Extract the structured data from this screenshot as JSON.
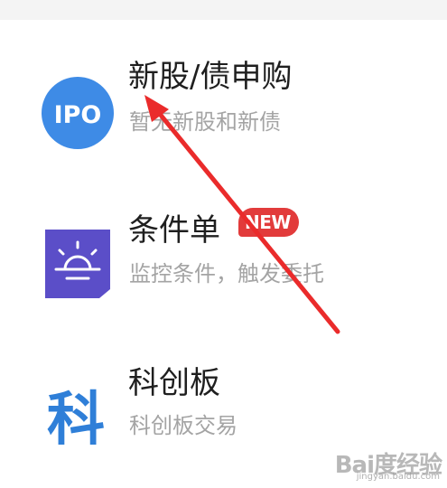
{
  "menu": {
    "items": [
      {
        "title": "新股/债申购",
        "subtitle": "暂无新股和新债",
        "icon": "ipo-icon",
        "icon_text": "IPO",
        "icon_color": "#3e8be6"
      },
      {
        "title": "条件单",
        "subtitle": "监控条件，触发委托",
        "icon": "lightbulb-icon",
        "icon_color": "#5b4ec8",
        "badge": "NEW",
        "badge_color": "#e23b3b"
      },
      {
        "title": "科创板",
        "subtitle": "科创板交易",
        "icon": "kechuang-icon",
        "icon_text": "科",
        "icon_color": "#2f7fd8"
      }
    ]
  },
  "watermark": {
    "logo_text": "Bai度经验",
    "url_text": "jingyan.baidu.com"
  },
  "annotation": {
    "type": "red-arrow",
    "color": "#ea2b2b"
  }
}
